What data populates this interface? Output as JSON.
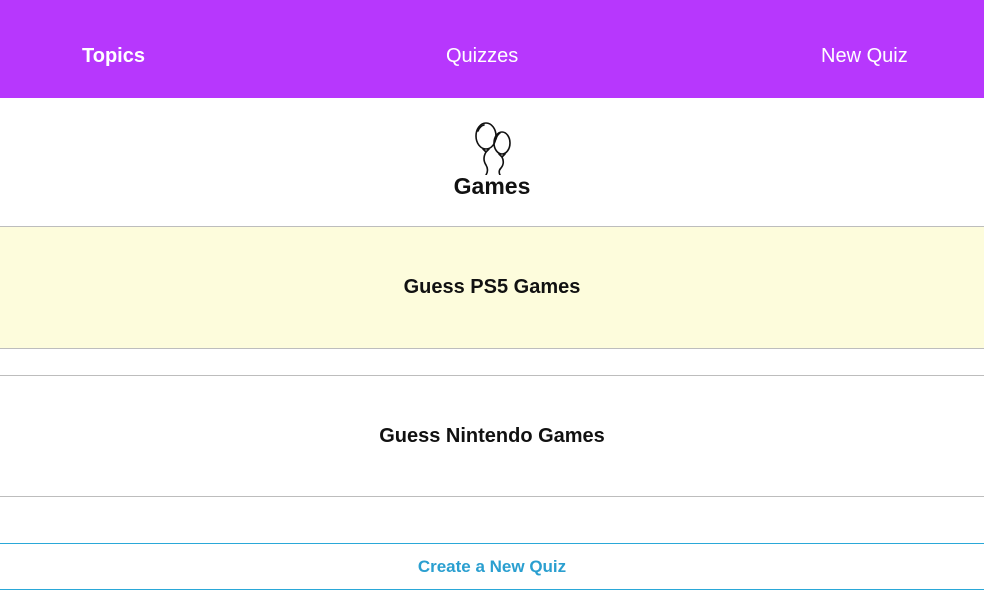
{
  "navbar": {
    "background_color": "#b737fd",
    "items": [
      {
        "label": "Topics",
        "active": true
      },
      {
        "label": "Quizzes",
        "active": false
      },
      {
        "label": "New Quiz",
        "active": false
      }
    ]
  },
  "topic": {
    "icon": "balloons-icon",
    "title": "Games"
  },
  "quizzes": [
    {
      "title": "Guess PS5 Games",
      "highlighted": true,
      "highlight_color": "#fdfcdc"
    },
    {
      "title": "Guess Nintendo Games",
      "highlighted": false
    }
  ],
  "create_quiz": {
    "label": "Create a New Quiz",
    "color": "#2a9fd0"
  }
}
